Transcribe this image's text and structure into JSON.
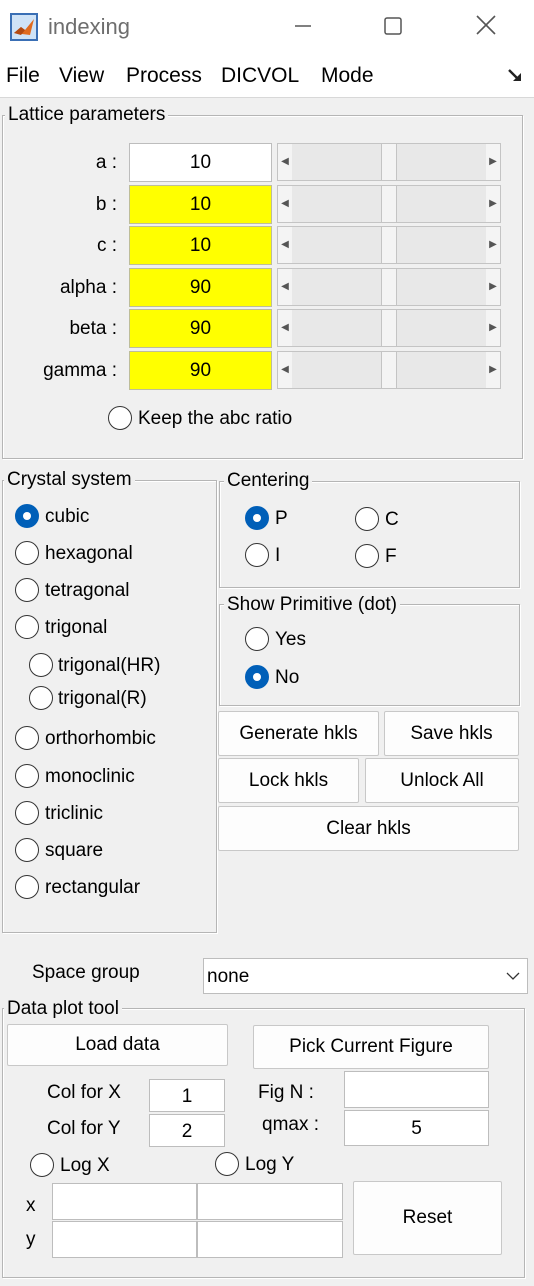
{
  "window": {
    "title": "indexing"
  },
  "menu": [
    "File",
    "View",
    "Process",
    "DICVOL",
    "Mode"
  ],
  "lattice": {
    "title": "Lattice parameters",
    "rows": [
      {
        "label": "a :",
        "value": "10"
      },
      {
        "label": "b :",
        "value": "10"
      },
      {
        "label": "c :",
        "value": "10"
      },
      {
        "label": "alpha :",
        "value": "90"
      },
      {
        "label": "beta :",
        "value": "90"
      },
      {
        "label": "gamma :",
        "value": "90"
      }
    ],
    "highlight_color": "#ffff00",
    "keep_ratio": "Keep the abc ratio"
  },
  "crystal": {
    "title": "Crystal system",
    "options": [
      "cubic",
      "hexagonal",
      "tetragonal",
      "trigonal",
      "trigonal(HR)",
      "trigonal(R)",
      "orthorhombic",
      "monoclinic",
      "triclinic",
      "square",
      "rectangular"
    ],
    "selected": "cubic"
  },
  "centering": {
    "title": "Centering",
    "p": "P",
    "c": "C",
    "i": "I",
    "f": "F",
    "selected": "P"
  },
  "primitive": {
    "title": "Show Primitive (dot)",
    "yes": "Yes",
    "no": "No",
    "selected": "No"
  },
  "buttons": {
    "generate": "Generate hkls",
    "save": "Save hkls",
    "lock": "Lock hkls",
    "unlock": "Unlock All",
    "clear": "Clear hkls"
  },
  "spacegroup": {
    "label": "Space group",
    "value": "none"
  },
  "dataplot": {
    "title": "Data plot tool",
    "load": "Load data",
    "pick": "Pick Current Figure",
    "colx_label": "Col for X",
    "colx": "1",
    "coly_label": "Col for Y",
    "coly": "2",
    "fign_label": "Fig N :",
    "fign": "",
    "qmax_label": "qmax :",
    "qmax": "5",
    "logx": "Log X",
    "logy": "Log Y",
    "x_label": "x",
    "y_label": "y",
    "reset": "Reset"
  },
  "colors": {
    "accent": "#005fb8"
  }
}
